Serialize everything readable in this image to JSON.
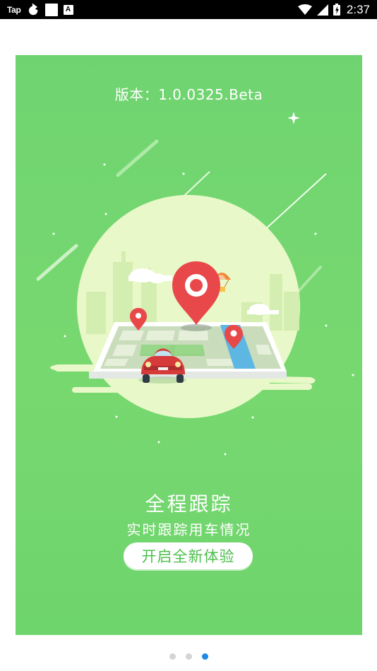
{
  "status_bar": {
    "left_label": "Tap",
    "a_label": "A",
    "time": "2:37"
  },
  "splash": {
    "version": "版本：1.0.0325.Beta",
    "headline": "全程跟踪",
    "subheadline": "实时跟踪用车情况",
    "button_label": "开启全新体验"
  },
  "pager": {
    "count": 3,
    "active_index": 2
  },
  "colors": {
    "card_green": "#6fd470",
    "pin_red": "#ea4b4b",
    "indicator_active": "#1e88e5",
    "indicator_inactive": "#d4d4d4"
  }
}
